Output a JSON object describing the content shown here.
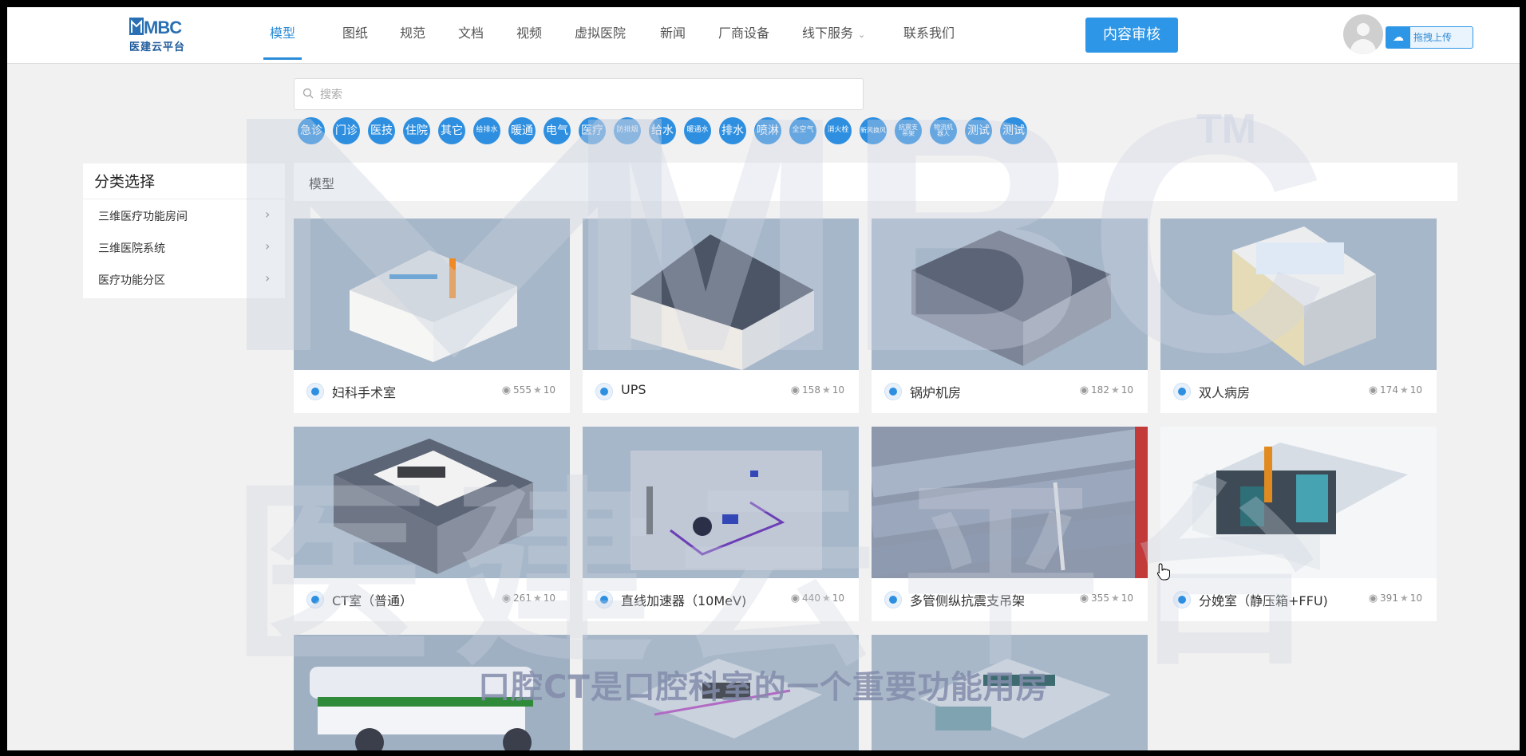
{
  "header": {
    "logo_text": "MBC",
    "logo_subtitle": "医建云平台",
    "nav": [
      {
        "label": "模型",
        "active": true
      },
      {
        "label": "图纸"
      },
      {
        "label": "规范"
      },
      {
        "label": "文档"
      },
      {
        "label": "视频"
      },
      {
        "label": "虚拟医院"
      },
      {
        "label": "新闻"
      },
      {
        "label": "厂商设备"
      },
      {
        "label": "线下服务",
        "dropdown": true
      },
      {
        "label": "联系我们"
      }
    ],
    "review_button": "内容审核",
    "upload_button": "拖拽上传"
  },
  "search": {
    "placeholder": "搜索",
    "value": ""
  },
  "tags": [
    "急诊",
    "门诊",
    "医技",
    "住院",
    "其它",
    "给排水",
    "暖通",
    "电气",
    "医疗",
    "防排烟",
    "给水",
    "暖通水",
    "排水",
    "喷淋",
    "全空气",
    "消火栓",
    "新风换风",
    "抗震支吊架",
    "物流机器人",
    "测试",
    "测试"
  ],
  "sidebar": {
    "title": "分类选择",
    "items": [
      {
        "label": "三维医疗功能房间"
      },
      {
        "label": "三维医院系统"
      },
      {
        "label": "医疗功能分区"
      }
    ]
  },
  "breadcrumb": "模型",
  "cards": [
    {
      "name": "妇科手术室",
      "views": "555",
      "stars": "10"
    },
    {
      "name": "UPS",
      "views": "158",
      "stars": "10"
    },
    {
      "name": "锅炉机房",
      "views": "182",
      "stars": "10"
    },
    {
      "name": "双人病房",
      "views": "174",
      "stars": "10"
    },
    {
      "name": "CT室（普通）",
      "views": "261",
      "stars": "10"
    },
    {
      "name": "直线加速器（10MeV)",
      "views": "440",
      "stars": "10"
    },
    {
      "name": "多管侧纵抗震支吊架",
      "views": "355",
      "stars": "10"
    },
    {
      "name": "分娩室（静压箱+FFU)",
      "views": "391",
      "stars": "10"
    }
  ],
  "watermark": {
    "text": "MBC",
    "tm": "TM",
    "cn": "医建云平台"
  },
  "subtitle": "口腔CT是口腔科室的一个重要功能用房",
  "colors": {
    "accent": "#2e8fe0",
    "page_bg": "#f1f1f1",
    "thumb_bg": "#a6b7c9"
  }
}
